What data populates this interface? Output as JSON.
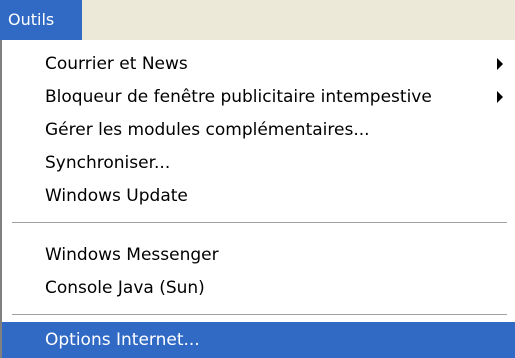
{
  "menubar": {
    "title": "Outils"
  },
  "menu": {
    "items": [
      {
        "label": "Courrier et News",
        "has_submenu": true
      },
      {
        "label": "Bloqueur de fenêtre publicitaire intempestive",
        "has_submenu": true
      },
      {
        "label": "Gérer les modules complémentaires...",
        "has_submenu": false
      },
      {
        "label": "Synchroniser...",
        "has_submenu": false
      },
      {
        "label": "Windows Update",
        "has_submenu": false
      },
      {
        "label": "Windows Messenger",
        "has_submenu": false
      },
      {
        "label": "Console Java (Sun)",
        "has_submenu": false
      },
      {
        "label": "Options Internet...",
        "has_submenu": false,
        "selected": true
      }
    ]
  },
  "colors": {
    "highlight": "#316ac5",
    "menubar_bg": "#ece9d8",
    "menu_bg": "#ffffff"
  },
  "icons": {
    "submenu_arrow": "triangle-right-icon"
  }
}
